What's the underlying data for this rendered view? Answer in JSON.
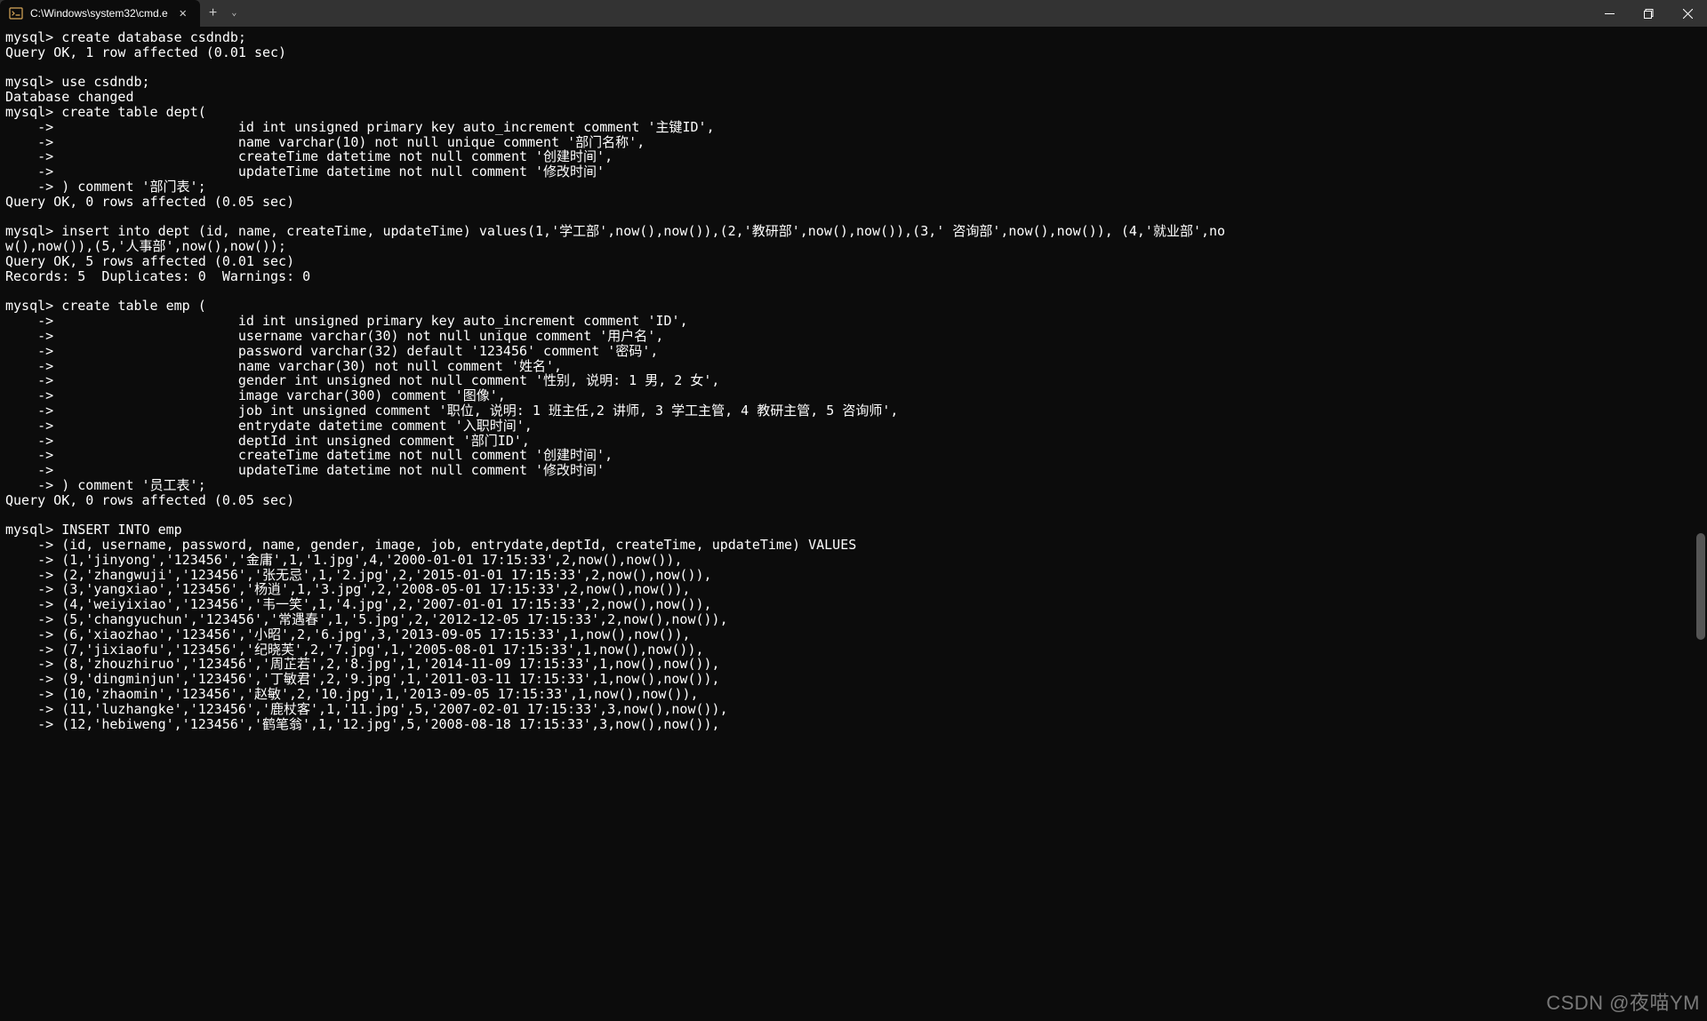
{
  "titlebar": {
    "tab_title": "C:\\Windows\\system32\\cmd.e",
    "close_glyph": "✕",
    "add_glyph": "+",
    "dropdown_glyph": "⌄"
  },
  "terminal_lines": [
    "mysql> create database csdndb;",
    "Query OK, 1 row affected (0.01 sec)",
    "",
    "mysql> use csdndb;",
    "Database changed",
    "mysql> create table dept(",
    "    ->                       id int unsigned primary key auto_increment comment '主键ID',",
    "    ->                       name varchar(10) not null unique comment '部门名称',",
    "    ->                       createTime datetime not null comment '创建时间',",
    "    ->                       updateTime datetime not null comment '修改时间'",
    "    -> ) comment '部门表';",
    "Query OK, 0 rows affected (0.05 sec)",
    "",
    "mysql> insert into dept (id, name, createTime, updateTime) values(1,'学工部',now(),now()),(2,'教研部',now(),now()),(3,' 咨询部',now(),now()), (4,'就业部',no",
    "w(),now()),(5,'人事部',now(),now());",
    "Query OK, 5 rows affected (0.01 sec)",
    "Records: 5  Duplicates: 0  Warnings: 0",
    "",
    "mysql> create table emp (",
    "    ->                       id int unsigned primary key auto_increment comment 'ID',",
    "    ->                       username varchar(30) not null unique comment '用户名',",
    "    ->                       password varchar(32) default '123456' comment '密码',",
    "    ->                       name varchar(30) not null comment '姓名',",
    "    ->                       gender int unsigned not null comment '性别, 说明: 1 男, 2 女',",
    "    ->                       image varchar(300) comment '图像',",
    "    ->                       job int unsigned comment '职位, 说明: 1 班主任,2 讲师, 3 学工主管, 4 教研主管, 5 咨询师',",
    "    ->                       entrydate datetime comment '入职时间',",
    "    ->                       deptId int unsigned comment '部门ID',",
    "    ->                       createTime datetime not null comment '创建时间',",
    "    ->                       updateTime datetime not null comment '修改时间'",
    "    -> ) comment '员工表';",
    "Query OK, 0 rows affected (0.05 sec)",
    "",
    "mysql> INSERT INTO emp",
    "    -> (id, username, password, name, gender, image, job, entrydate,deptId, createTime, updateTime) VALUES",
    "    -> (1,'jinyong','123456','金庸',1,'1.jpg',4,'2000-01-01 17:15:33',2,now(),now()),",
    "    -> (2,'zhangwuji','123456','张无忌',1,'2.jpg',2,'2015-01-01 17:15:33',2,now(),now()),",
    "    -> (3,'yangxiao','123456','杨逍',1,'3.jpg',2,'2008-05-01 17:15:33',2,now(),now()),",
    "    -> (4,'weiyixiao','123456','韦一笑',1,'4.jpg',2,'2007-01-01 17:15:33',2,now(),now()),",
    "    -> (5,'changyuchun','123456','常遇春',1,'5.jpg',2,'2012-12-05 17:15:33',2,now(),now()),",
    "    -> (6,'xiaozhao','123456','小昭',2,'6.jpg',3,'2013-09-05 17:15:33',1,now(),now()),",
    "    -> (7,'jixiaofu','123456','纪晓芙',2,'7.jpg',1,'2005-08-01 17:15:33',1,now(),now()),",
    "    -> (8,'zhouzhiruo','123456','周芷若',2,'8.jpg',1,'2014-11-09 17:15:33',1,now(),now()),",
    "    -> (9,'dingminjun','123456','丁敏君',2,'9.jpg',1,'2011-03-11 17:15:33',1,now(),now()),",
    "    -> (10,'zhaomin','123456','赵敏',2,'10.jpg',1,'2013-09-05 17:15:33',1,now(),now()),",
    "    -> (11,'luzhangke','123456','鹿杖客',1,'11.jpg',5,'2007-02-01 17:15:33',3,now(),now()),",
    "    -> (12,'hebiweng','123456','鹤笔翁',1,'12.jpg',5,'2008-08-18 17:15:33',3,now(),now()),"
  ],
  "watermark": "CSDN @夜喵YM"
}
